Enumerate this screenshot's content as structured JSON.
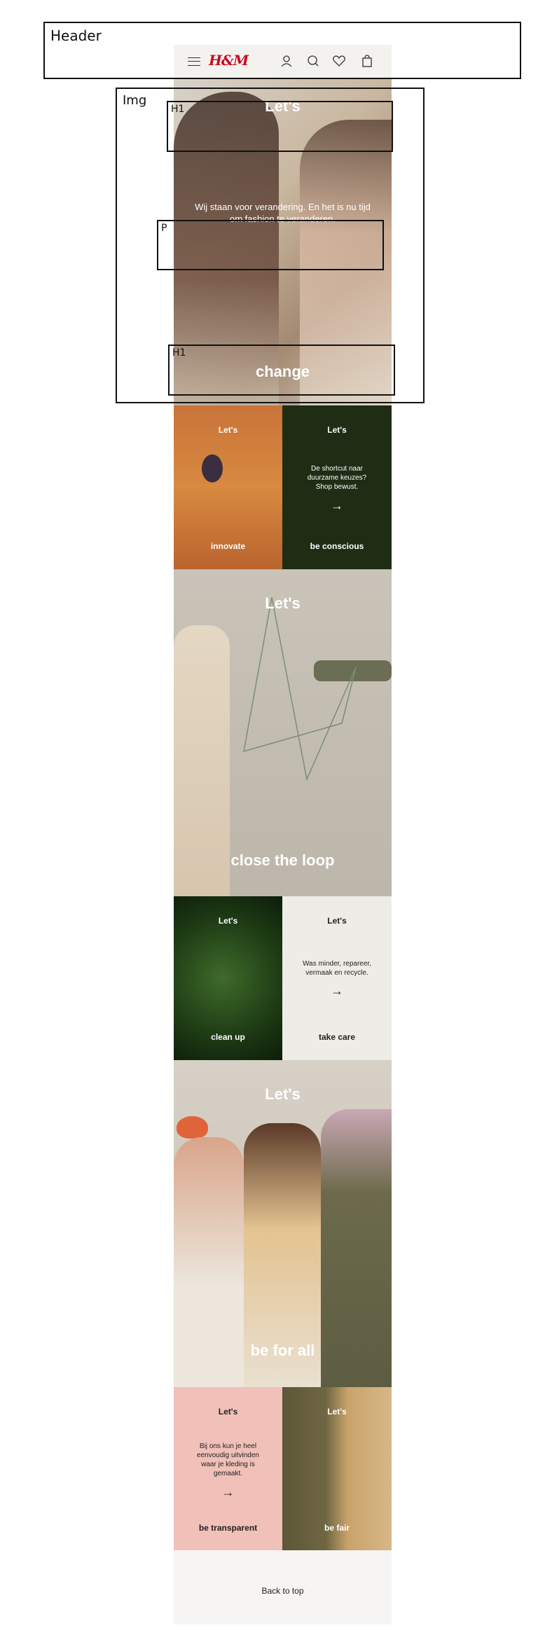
{
  "annotations": {
    "header": "Header",
    "img": "Img",
    "h1_top": "H1",
    "p": "P",
    "h1_bottom": "H1"
  },
  "nav": {
    "logo": "H&M",
    "icons": [
      "menu-icon",
      "account-icon",
      "search-icon",
      "heart-icon",
      "bag-icon"
    ]
  },
  "hero": {
    "lets": "Let's",
    "text": "Wij staan voor verandering. En het is nu tijd om fashion te veranderen.",
    "word": "change"
  },
  "row1": {
    "left": {
      "lets": "Let's",
      "word": "innovate"
    },
    "right": {
      "lets": "Let's",
      "text": "De shortcut naar duurzame keuzes? Shop bewust.",
      "word": "be conscious"
    }
  },
  "loop": {
    "lets": "Let's",
    "word": "close the loop"
  },
  "row2": {
    "left": {
      "lets": "Let's",
      "word": "clean up"
    },
    "right": {
      "lets": "Let's",
      "text": "Was minder, repareer, vermaak en recycle.",
      "word": "take care"
    }
  },
  "forall": {
    "lets": "Let's",
    "word": "be for all"
  },
  "row3": {
    "left": {
      "lets": "Let's",
      "text": "Bij ons kun je heel eenvoudig uitvinden waar je kleding is gemaakt.",
      "word": "be transparent"
    },
    "right": {
      "lets": "Let's",
      "word": "be fair"
    }
  },
  "footer": {
    "back": "Back to top"
  },
  "colors": {
    "logo_red": "#cc071e",
    "dark_green": "#1e2d14",
    "light_panel": "#eeece7",
    "pink": "#f1c0b9"
  }
}
